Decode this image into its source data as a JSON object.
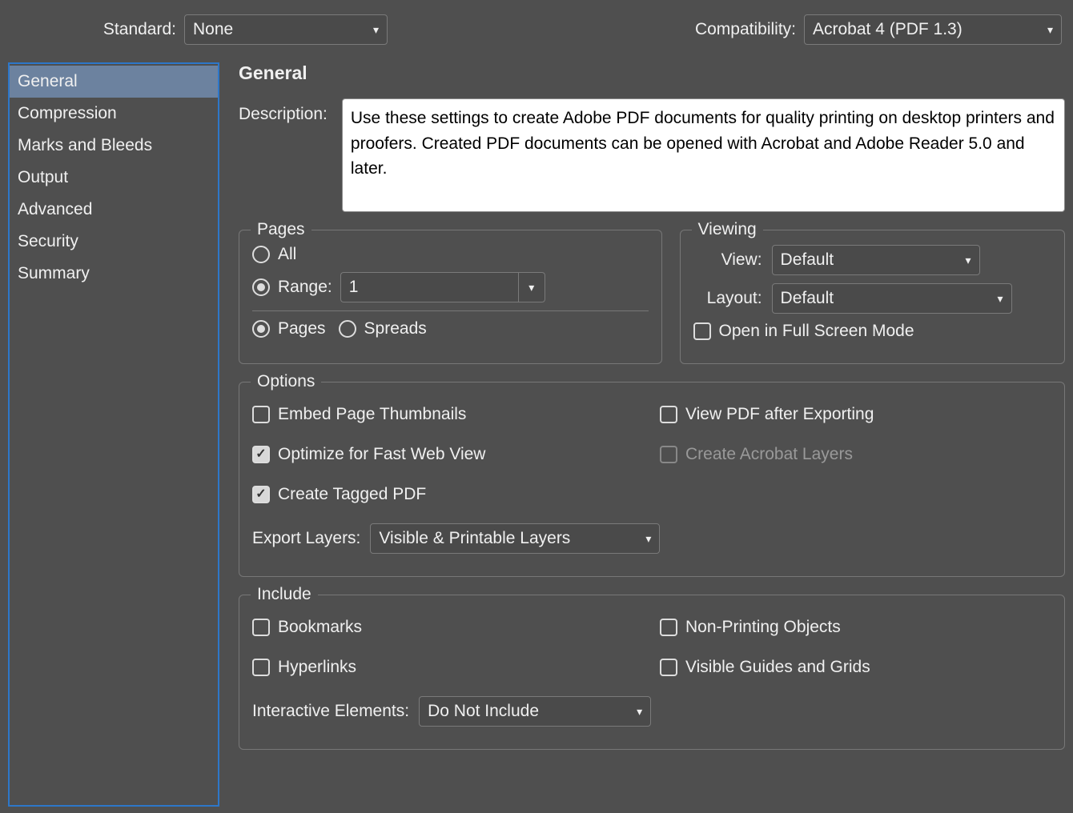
{
  "topbar": {
    "standard_label": "Standard:",
    "standard_value": "None",
    "compat_label": "Compatibility:",
    "compat_value": "Acrobat 4 (PDF 1.3)"
  },
  "sidebar": {
    "items": [
      "General",
      "Compression",
      "Marks and Bleeds",
      "Output",
      "Advanced",
      "Security",
      "Summary"
    ],
    "active": 0
  },
  "general": {
    "title": "General",
    "description_label": "Description:",
    "description_text": "Use these settings to create Adobe PDF documents for quality printing on desktop printers and proofers.  Created PDF documents can be opened with Acrobat and Adobe Reader 5.0 and later."
  },
  "pages": {
    "legend": "Pages",
    "all_label": "All",
    "range_label": "Range:",
    "range_value": "1",
    "pages_label": "Pages",
    "spreads_label": "Spreads"
  },
  "viewing": {
    "legend": "Viewing",
    "view_label": "View:",
    "view_value": "Default",
    "layout_label": "Layout:",
    "layout_value": "Default",
    "fullscreen_label": "Open in Full Screen Mode"
  },
  "options": {
    "legend": "Options",
    "embed_thumbs": "Embed Page Thumbnails",
    "optimize_fast": "Optimize for Fast Web View",
    "tagged_pdf": "Create Tagged PDF",
    "view_after": "View PDF after Exporting",
    "acrobat_layers": "Create Acrobat Layers",
    "export_layers_label": "Export Layers:",
    "export_layers_value": "Visible & Printable Layers"
  },
  "include": {
    "legend": "Include",
    "bookmarks": "Bookmarks",
    "hyperlinks": "Hyperlinks",
    "nonprinting": "Non-Printing Objects",
    "guides": "Visible Guides and Grids",
    "interactive_label": "Interactive Elements:",
    "interactive_value": "Do Not Include"
  }
}
